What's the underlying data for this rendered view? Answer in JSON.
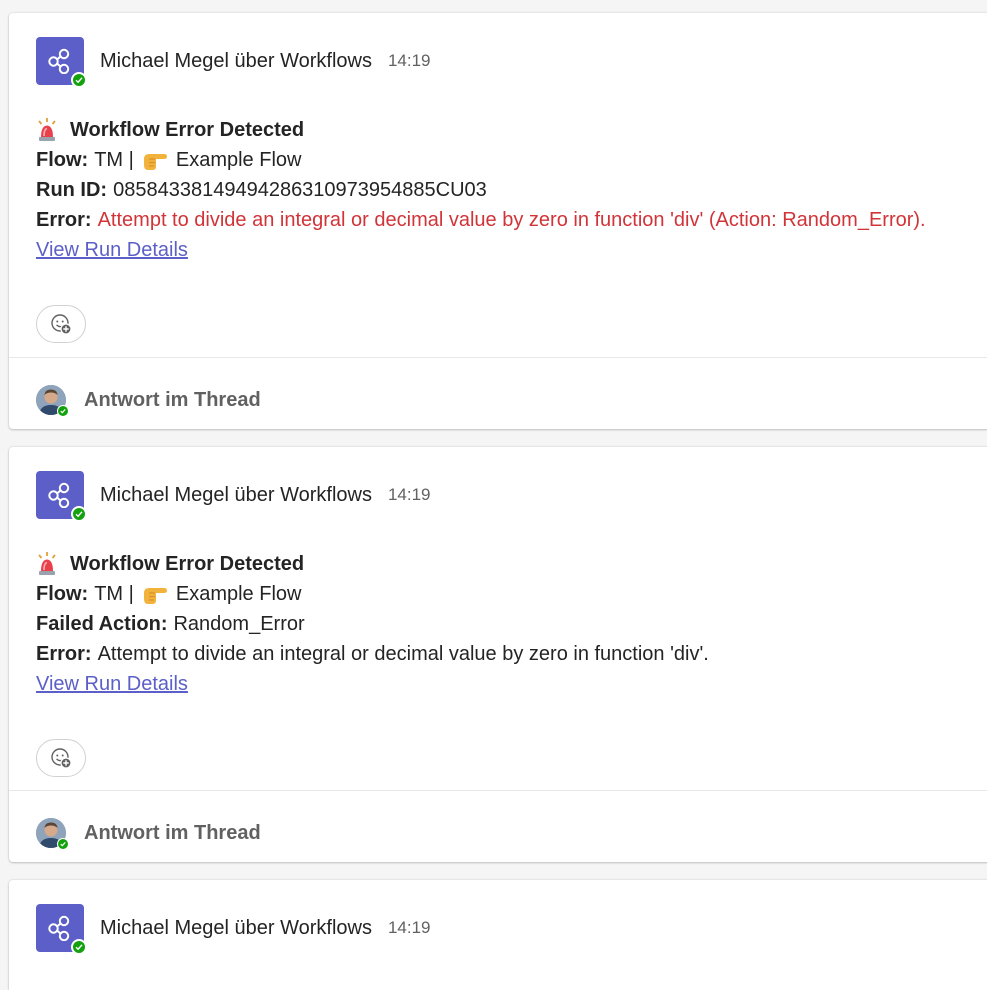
{
  "messages": [
    {
      "sender": "Michael Megel über Workflows",
      "time": "14:19",
      "title": "Workflow Error Detected",
      "flow_label": "Flow:",
      "flow_prefix": "TM |",
      "flow_name": "Example Flow",
      "row3_label": "Run ID:",
      "row3_value": "08584338149494286310973954885CU03",
      "error_label": "Error:",
      "error_text": "Attempt to divide an integral or decimal value by zero in function 'div' (Action: Random_Error).",
      "error_color": "#d13438",
      "link_text": "View Run Details",
      "reply_label": "Antwort im Thread"
    },
    {
      "sender": "Michael Megel über Workflows",
      "time": "14:19",
      "title": "Workflow Error Detected",
      "flow_label": "Flow:",
      "flow_prefix": "TM |",
      "flow_name": "Example Flow",
      "row3_label": "Failed Action:",
      "row3_value": "Random_Error",
      "error_label": "Error:",
      "error_text": "Attempt to divide an integral or decimal value by zero in function 'div'.",
      "error_color": "#242424",
      "link_text": "View Run Details",
      "reply_label": "Antwort im Thread"
    },
    {
      "sender": "Michael Megel über Workflows",
      "time": "14:19"
    }
  ],
  "icons": {
    "app": "workflows-share-icon",
    "presence": "available-check-icon",
    "title_emoji": "rotating-light-emoji",
    "flow_emoji": "backhand-index-pointing-right-emoji",
    "reaction": "add-reaction-icon"
  },
  "colors": {
    "accent": "#5b5fc7",
    "presence": "#13a10e",
    "error": "#d13438"
  }
}
